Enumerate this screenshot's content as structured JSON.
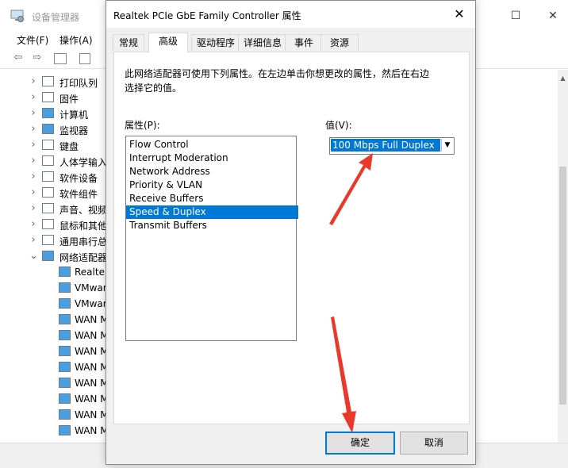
{
  "device_manager": {
    "title": "设备管理器",
    "menu": [
      {
        "label": "文件(F)"
      },
      {
        "label": "操作(A)"
      }
    ],
    "tree": [
      {
        "label": "打印队列",
        "icon": "printer-icon",
        "expanded": false,
        "indent": 0
      },
      {
        "label": "固件",
        "icon": "chip-icon",
        "expanded": false,
        "indent": 0
      },
      {
        "label": "计算机",
        "icon": "computer-icon",
        "expanded": false,
        "indent": 0
      },
      {
        "label": "监视器",
        "icon": "monitor-icon",
        "expanded": false,
        "indent": 0
      },
      {
        "label": "键盘",
        "icon": "keyboard-icon",
        "expanded": false,
        "indent": 0
      },
      {
        "label": "人体学输入",
        "icon": "hid-icon",
        "expanded": false,
        "indent": 0
      },
      {
        "label": "软件设备",
        "icon": "software-device-icon",
        "expanded": false,
        "indent": 0
      },
      {
        "label": "软件组件",
        "icon": "software-component-icon",
        "expanded": false,
        "indent": 0
      },
      {
        "label": "声音、视频",
        "icon": "speaker-icon",
        "expanded": false,
        "indent": 0
      },
      {
        "label": "鼠标和其他",
        "icon": "mouse-icon",
        "expanded": false,
        "indent": 0
      },
      {
        "label": "通用串行总",
        "icon": "usb-icon",
        "expanded": false,
        "indent": 0
      },
      {
        "label": "网络适配器",
        "icon": "network-icon",
        "expanded": true,
        "indent": 0
      },
      {
        "label": "Realtek",
        "icon": "network-adapter-icon",
        "indent": 1
      },
      {
        "label": "VMwar",
        "icon": "network-adapter-icon",
        "indent": 1
      },
      {
        "label": "VMwar",
        "icon": "network-adapter-icon",
        "indent": 1
      },
      {
        "label": "WAN M",
        "icon": "network-adapter-icon",
        "indent": 1
      },
      {
        "label": "WAN M",
        "icon": "network-adapter-icon",
        "indent": 1
      },
      {
        "label": "WAN M",
        "icon": "network-adapter-icon",
        "indent": 1
      },
      {
        "label": "WAN M",
        "icon": "network-adapter-icon",
        "indent": 1
      },
      {
        "label": "WAN M",
        "icon": "network-adapter-icon",
        "indent": 1
      },
      {
        "label": "WAN M",
        "icon": "network-adapter-icon",
        "indent": 1
      },
      {
        "label": "WAN M",
        "icon": "network-adapter-icon",
        "indent": 1
      },
      {
        "label": "WAN M",
        "icon": "network-adapter-icon",
        "indent": 1
      }
    ]
  },
  "dialog": {
    "title": "Realtek PCIe GbE Family Controller 属性",
    "tabs": [
      {
        "label": "常规",
        "active": false
      },
      {
        "label": "高级",
        "active": true
      },
      {
        "label": "驱动程序",
        "active": false
      },
      {
        "label": "详细信息",
        "active": false
      },
      {
        "label": "事件",
        "active": false
      },
      {
        "label": "资源",
        "active": false
      }
    ],
    "description": "此网络适配器可使用下列属性。在左边单击你想更改的属性，然后在右边选择它的值。",
    "properties_label": "属性(P):",
    "value_label": "值(V):",
    "properties": [
      "Flow Control",
      "Interrupt Moderation",
      "Network Address",
      "Priority & VLAN",
      "Receive Buffers",
      "Speed & Duplex",
      "Transmit Buffers"
    ],
    "selected_property": "Speed & Duplex",
    "value": "100 Mbps Full Duplex",
    "ok_label": "确定",
    "cancel_label": "取消"
  },
  "colors": {
    "selection": "#0078d7",
    "annotation_arrow": "#e8392b"
  }
}
